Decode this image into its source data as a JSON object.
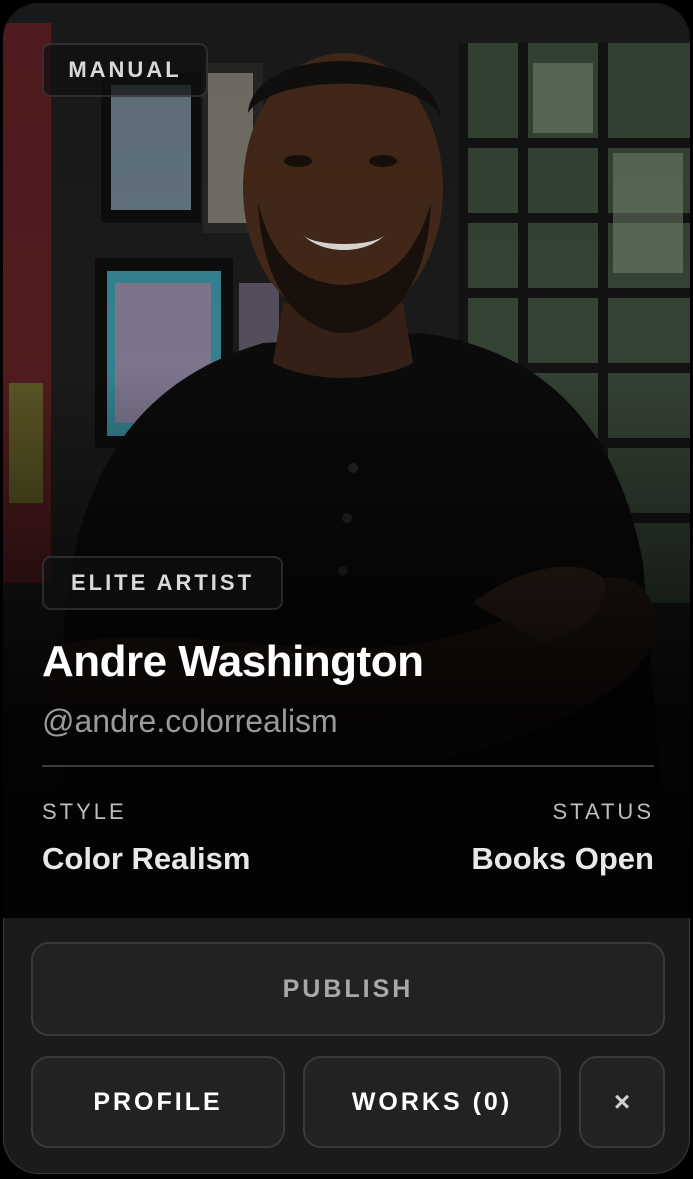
{
  "card": {
    "source_badge": "MANUAL",
    "tier_badge": "ELITE ARTIST",
    "name": "Andre Washington",
    "handle": "@andre.colorrealism",
    "style_label": "STYLE",
    "style_value": "Color Realism",
    "status_label": "STATUS",
    "status_value": "Books Open"
  },
  "actions": {
    "publish_label": "PUBLISH",
    "profile_label": "PROFILE",
    "works_label": "WORKS (0)",
    "close_label": "×"
  },
  "icons": {
    "close": "close-icon"
  },
  "colors": {
    "card_bg": "#1b1b1b",
    "button_bg": "#222222",
    "button_border": "#3a3a3a",
    "text_primary": "#ffffff",
    "text_muted": "#9a9a9a"
  }
}
